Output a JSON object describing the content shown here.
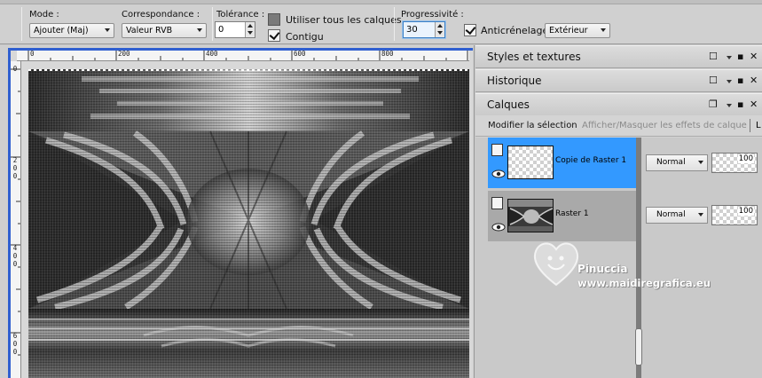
{
  "toolbar": {
    "mode_label": "Mode :",
    "mode_value": "Ajouter (Maj)",
    "match_label": "Correspondance :",
    "match_value": "Valeur RVB",
    "tolerance_label": "Tolérance :",
    "tolerance_value": "0",
    "use_all_layers_label": "Utiliser tous les calques",
    "contiguous_label": "Contigu",
    "feather_label": "Progressivité :",
    "feather_value": "30",
    "antialias_label": "Anticrénelage",
    "antialias_value": "Extérieur"
  },
  "rulers": {
    "horizontal": [
      "0",
      "200",
      "400",
      "600",
      "800"
    ],
    "vertical": [
      [
        "0"
      ],
      [
        "2",
        "0",
        "0"
      ],
      [
        "4",
        "0",
        "0"
      ],
      [
        "6",
        "0",
        "0"
      ]
    ]
  },
  "panels": {
    "styles_title": "Styles et textures",
    "history_title": "Historique",
    "layers_title": "Calques",
    "modify_selection": "Modifier la sélection",
    "toggle_effects": "Afficher/Masquer les effets de calque",
    "cut_letter": "L"
  },
  "layers": [
    {
      "name": "Copie de Raster 1",
      "blend": "Normal",
      "opacity": "100",
      "selected": true
    },
    {
      "name": "Raster 1",
      "blend": "Normal",
      "opacity": "100",
      "selected": false
    }
  ],
  "watermark": {
    "name": "Pinuccia",
    "url": "www.maidiregrafica.eu"
  },
  "colors": {
    "selection_blue": "#3399ff",
    "document_border": "#2f5fd0"
  }
}
